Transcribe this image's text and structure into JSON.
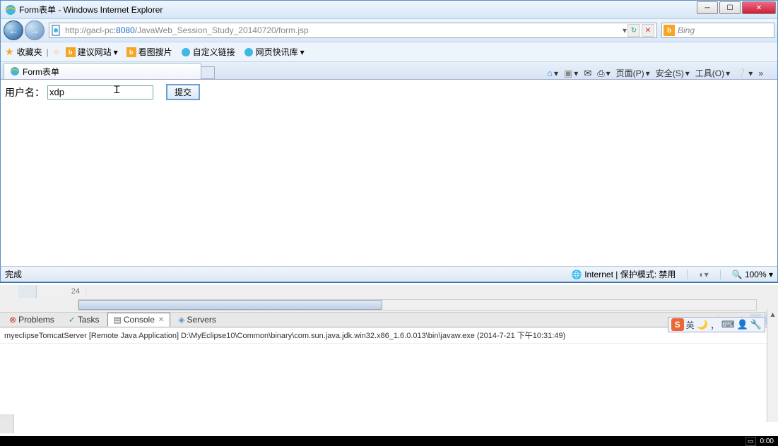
{
  "window": {
    "title": "Form表单 - Windows Internet Explorer"
  },
  "nav": {
    "url_prefix": "http://",
    "url_host": "gacl-pc",
    "url_port": ":8080",
    "url_path": "/JavaWeb_Session_Study_20140720/form.jsp"
  },
  "search": {
    "placeholder": "Bing"
  },
  "favbar": {
    "label": "收藏夹",
    "links": [
      "建议网站",
      "看图搜片",
      "自定义链接",
      "网页快讯库"
    ]
  },
  "tab": {
    "title": "Form表单"
  },
  "toolbar": {
    "page": "页面(P)",
    "safety": "安全(S)",
    "tools": "工具(O)"
  },
  "form": {
    "username_label": "用户名：",
    "username_value": "xdp",
    "submit": "提交"
  },
  "status": {
    "left": "完成",
    "zone": "Internet | 保护模式: 禁用",
    "zoom": "100%"
  },
  "editor": {
    "line": "24"
  },
  "eclipse_tabs": {
    "problems": "Problems",
    "tasks": "Tasks",
    "console": "Console",
    "servers": "Servers"
  },
  "console": {
    "line": "myeclipseTomcatServer [Remote Java Application] D:\\MyEclipse10\\Common\\binary\\com.sun.java.jdk.win32.x86_1.6.0.013\\bin\\javaw.exe (2014-7-21 下午10:31:49)"
  },
  "ime": {
    "lang": "英"
  },
  "taskbar": {
    "time": "0:00"
  }
}
